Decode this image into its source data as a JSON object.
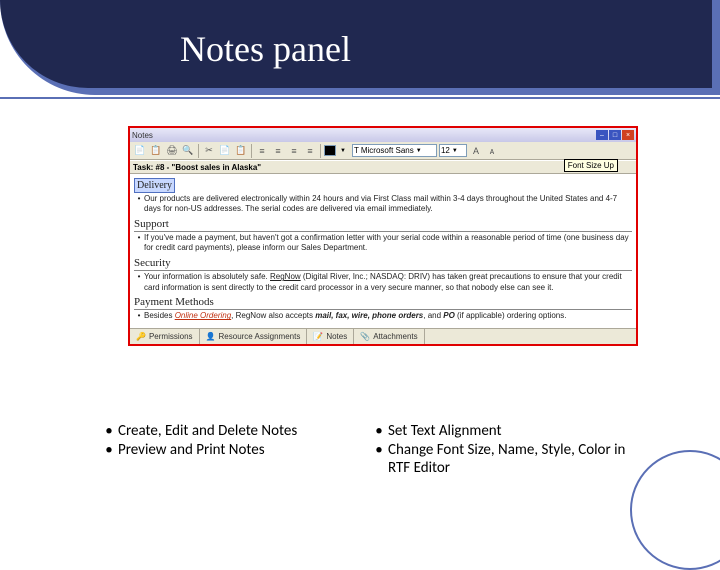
{
  "slide": {
    "title": "Notes panel"
  },
  "panel": {
    "title": "Notes",
    "task_label": "Task: #8 - \"Boost sales in Alaska\"",
    "tooltip": "Font Size Up",
    "font_name": "Microsoft Sans",
    "font_size": "12"
  },
  "doc": {
    "h_delivery": "Delivery",
    "p_delivery": "Our products are delivered electronically within 24 hours and via First Class mail within 3-4 days throughout the United States and 4-7 days for non-US addresses. The serial codes are delivered via email immediately.",
    "h_support": "Support",
    "p_support": "If you've made a payment, but haven't got a confirmation letter with your serial code within a reasonable period of time (one business day for credit card payments), please inform our Sales Department.",
    "h_security": "Security",
    "p_security_a": "Your information is absolutely safe. ",
    "p_security_link": "RegNow",
    "p_security_b": " (Digital River, Inc.; NASDAQ: DRIV) has taken great precautions to ensure that your credit card information is sent directly to the credit card processor in a very secure manner, so that nobody else can see it.",
    "h_payment": "Payment Methods",
    "p_payment_a": "Besides ",
    "p_payment_online": "Online Ordering",
    "p_payment_b": ", RegNow also accepts ",
    "p_payment_methods": "mail, fax, wire, phone orders",
    "p_payment_c": ", and ",
    "p_payment_po": "PO",
    "p_payment_d": " (if applicable) ordering options."
  },
  "tabs": {
    "permissions": "Permissions",
    "resource": "Resource Assignments",
    "notes": "Notes",
    "attachments": "Attachments"
  },
  "features": {
    "left": [
      "Create, Edit and Delete Notes",
      "Preview and Print Notes"
    ],
    "right": [
      "Set Text Alignment",
      "Change Font Size, Name, Style, Color in RTF Editor"
    ]
  }
}
